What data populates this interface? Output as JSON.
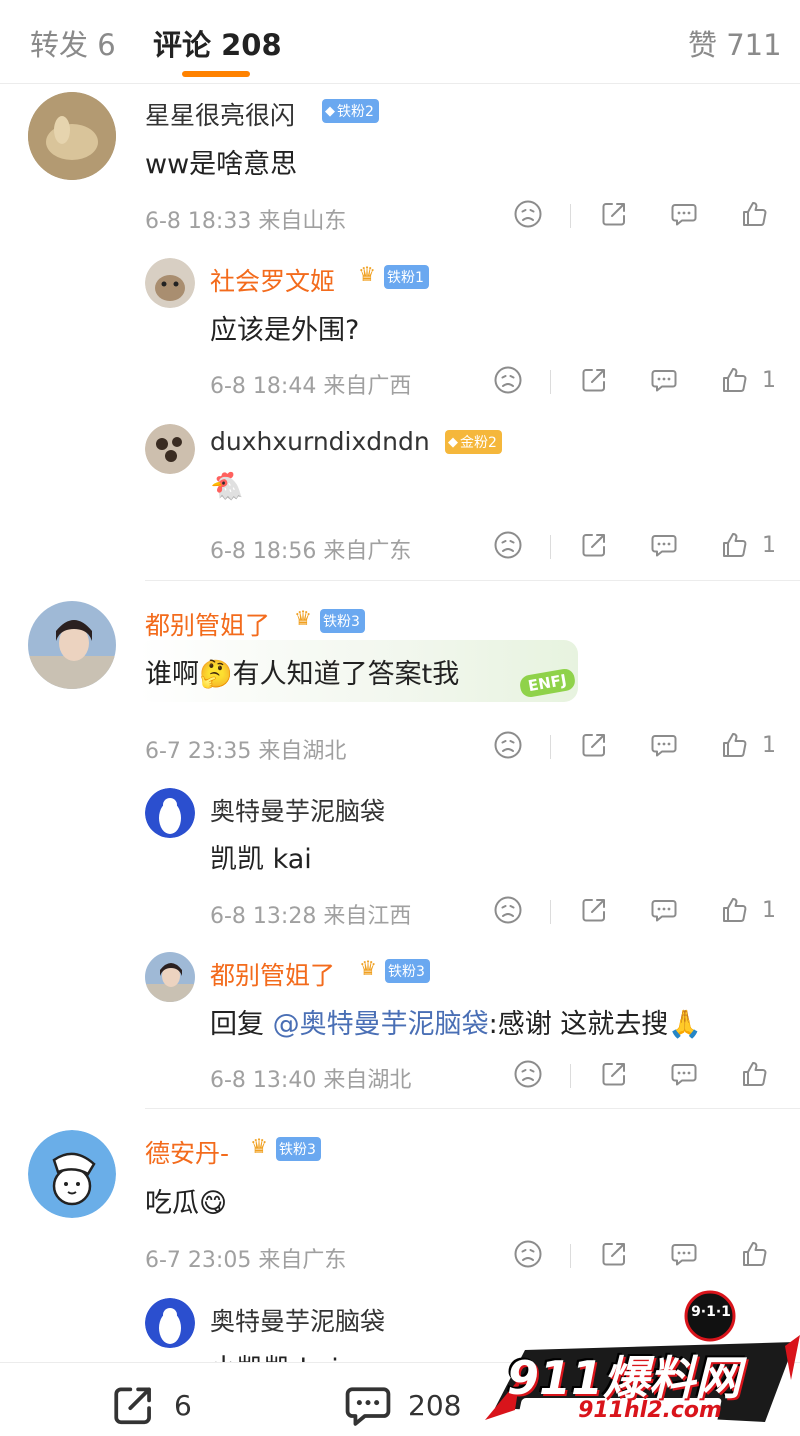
{
  "tabs": {
    "forward": "转发 6",
    "comments": "评论 208",
    "likes": "赞 711"
  },
  "comments": [
    {
      "name": "星星很亮很闪",
      "badge": "铁粉2",
      "text": "ww是啥意思",
      "time": "6-8 18:33",
      "location": "来自山东",
      "likes": ""
    },
    {
      "name": "社会罗文姬",
      "badge": "铁粉1",
      "text": "应该是外围?",
      "time": "6-8 18:44",
      "location": "来自广西",
      "likes": "1"
    },
    {
      "name": "duxhxurndixdndn",
      "badge": "金粉2",
      "text": "🐔",
      "time": "6-8 18:56",
      "location": "来自广东",
      "likes": "1"
    },
    {
      "name": "都别管姐了",
      "badge": "铁粉3",
      "text": "谁啊🤔有人知道了答案t我",
      "sticker": "ENFJ",
      "time": "6-7 23:35",
      "location": "来自湖北",
      "likes": "1"
    },
    {
      "name": "奥特曼芋泥脑袋",
      "text": "凯凯 kai",
      "time": "6-8 13:28",
      "location": "来自江西",
      "likes": "1"
    },
    {
      "name": "都别管姐了",
      "badge": "铁粉3",
      "reply_prefix": "回复 ",
      "mention": "@奥特曼芋泥脑袋",
      "text": ":感谢 这就去搜🙏",
      "time": "6-8 13:40",
      "location": "来自湖北",
      "likes": ""
    },
    {
      "name": "德安丹-",
      "badge": "铁粉3",
      "text": "吃瓜😋",
      "time": "6-7 23:05",
      "location": "来自广东",
      "likes": ""
    },
    {
      "name": "奥特曼芋泥脑袋",
      "text": "小凯凯 kai"
    }
  ],
  "bottombar": {
    "forward_count": "6",
    "comment_count": "208"
  },
  "watermark": {
    "badge": "9·1·1",
    "logo": "911爆料网",
    "url": "911hl2.com"
  },
  "colors": {
    "accent": "#ff8200",
    "vip_name": "#f36b1c",
    "mention": "#4a6fb5",
    "fan_badge": "#6aa8f0",
    "gold_badge": "#f5b73b"
  }
}
